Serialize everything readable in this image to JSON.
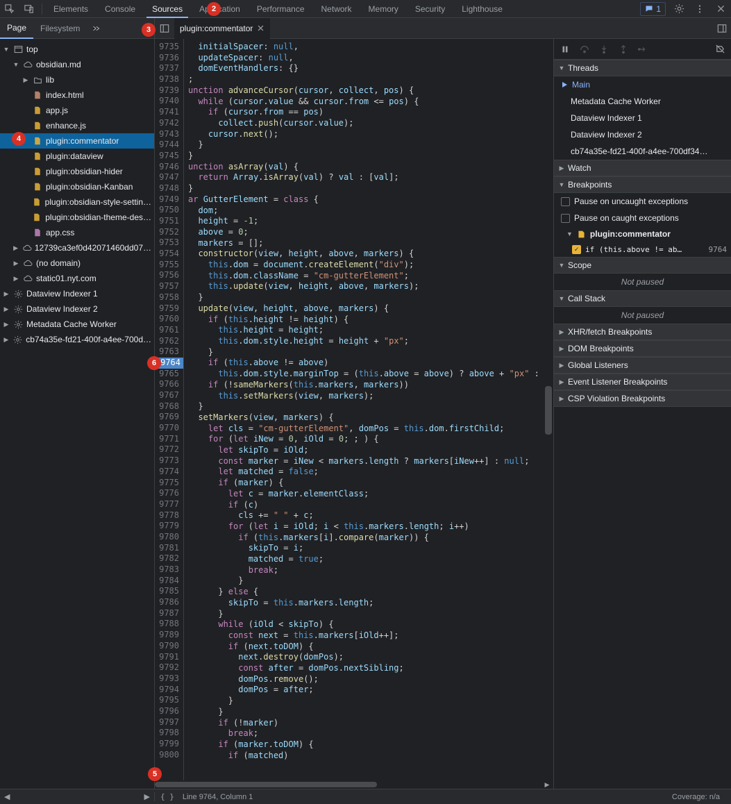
{
  "top_tabs": [
    "Elements",
    "Console",
    "Sources",
    "Application",
    "Performance",
    "Network",
    "Memory",
    "Security",
    "Lighthouse"
  ],
  "top_tab_active": 2,
  "msg_count": "1",
  "nav_tabs": [
    "Page",
    "Filesystem"
  ],
  "nav_tab_active": 0,
  "open_file": {
    "name": "plugin:commentator"
  },
  "tree": [
    {
      "d": 0,
      "tw": "▼",
      "ic": "win",
      "label": "top"
    },
    {
      "d": 1,
      "tw": "▼",
      "ic": "cloud",
      "label": "obsidian.md"
    },
    {
      "d": 2,
      "tw": "▶",
      "ic": "folder",
      "label": "lib"
    },
    {
      "d": 2,
      "tw": "",
      "ic": "html",
      "label": "index.html"
    },
    {
      "d": 2,
      "tw": "",
      "ic": "js",
      "label": "app.js"
    },
    {
      "d": 2,
      "tw": "",
      "ic": "js",
      "label": "enhance.js"
    },
    {
      "d": 2,
      "tw": "",
      "ic": "js",
      "label": "plugin:commentator",
      "sel": true
    },
    {
      "d": 2,
      "tw": "",
      "ic": "js",
      "label": "plugin:dataview"
    },
    {
      "d": 2,
      "tw": "",
      "ic": "js",
      "label": "plugin:obsidian-hider"
    },
    {
      "d": 2,
      "tw": "",
      "ic": "js",
      "label": "plugin:obsidian-Kanban"
    },
    {
      "d": 2,
      "tw": "",
      "ic": "js",
      "label": "plugin:obsidian-style-settin…"
    },
    {
      "d": 2,
      "tw": "",
      "ic": "js",
      "label": "plugin:obsidian-theme-des…"
    },
    {
      "d": 2,
      "tw": "",
      "ic": "css",
      "label": "app.css"
    },
    {
      "d": 1,
      "tw": "▶",
      "ic": "cloud",
      "label": "12739ca3ef0d42071460dd07…"
    },
    {
      "d": 1,
      "tw": "▶",
      "ic": "cloud",
      "label": "(no domain)"
    },
    {
      "d": 1,
      "tw": "▶",
      "ic": "cloud",
      "label": "static01.nyt.com"
    },
    {
      "d": 0,
      "tw": "▶",
      "ic": "gear",
      "label": "Dataview Indexer 1"
    },
    {
      "d": 0,
      "tw": "▶",
      "ic": "gear",
      "label": "Dataview Indexer 2"
    },
    {
      "d": 0,
      "tw": "▶",
      "ic": "gear",
      "label": "Metadata Cache Worker"
    },
    {
      "d": 0,
      "tw": "▶",
      "ic": "gear",
      "label": "cb74a35e-fd21-400f-a4ee-700d…"
    }
  ],
  "gutter_start": 9735,
  "gutter_end": 9800,
  "gutter_bp": 9764,
  "code_lines": [
    "  <span class='prop'>initialSpacer</span>: <span class='bool'>null</span>,",
    "  <span class='prop'>updateSpacer</span>: <span class='bool'>null</span>,",
    "  <span class='prop'>domEventHandlers</span>: {}",
    ";",
    "<span class='kw'>unction</span> <span class='fn'>advanceCursor</span>(<span class='prop'>cursor</span>, <span class='prop'>collect</span>, <span class='prop'>pos</span>) {",
    "  <span class='kw'>while</span> (<span class='prop'>cursor</span>.<span class='prop'>value</span> && <span class='prop'>cursor</span>.<span class='prop'>from</span> &lt;= <span class='prop'>pos</span>) {",
    "    <span class='kw'>if</span> (<span class='prop'>cursor</span>.<span class='prop'>from</span> == <span class='prop'>pos</span>)",
    "      <span class='prop'>collect</span>.<span class='fn'>push</span>(<span class='prop'>cursor</span>.<span class='prop'>value</span>);",
    "    <span class='prop'>cursor</span>.<span class='fn'>next</span>();",
    "  }",
    "}",
    "<span class='kw'>unction</span> <span class='fn'>asArray</span>(<span class='prop'>val</span>) {",
    "  <span class='kw'>return</span> <span class='prop'>Array</span>.<span class='fn'>isArray</span>(<span class='prop'>val</span>) ? <span class='prop'>val</span> : [<span class='prop'>val</span>];",
    "}",
    "<span class='kw'>ar</span> <span class='prop'>GutterElement</span> = <span class='kw'>class</span> {",
    "  <span class='prop'>dom</span>;",
    "  <span class='prop'>height</span> = <span class='num'>-1</span>;",
    "  <span class='prop'>above</span> = <span class='num'>0</span>;",
    "  <span class='prop'>markers</span> = [];",
    "  <span class='fn'>constructor</span>(<span class='prop'>view</span>, <span class='prop'>height</span>, <span class='prop'>above</span>, <span class='prop'>markers</span>) {",
    "    <span class='bool'>this</span>.<span class='prop'>dom</span> = <span class='prop'>document</span>.<span class='fn'>createElement</span>(<span class='str'>\"div\"</span>);",
    "    <span class='bool'>this</span>.<span class='prop'>dom</span>.<span class='prop'>className</span> = <span class='str'>\"cm-gutterElement\"</span>;",
    "    <span class='bool'>this</span>.<span class='fn'>update</span>(<span class='prop'>view</span>, <span class='prop'>height</span>, <span class='prop'>above</span>, <span class='prop'>markers</span>);",
    "  }",
    "  <span class='fn'>update</span>(<span class='prop'>view</span>, <span class='prop'>height</span>, <span class='prop'>above</span>, <span class='prop'>markers</span>) {",
    "    <span class='kw'>if</span> (<span class='bool'>this</span>.<span class='prop'>height</span> != <span class='prop'>height</span>) {",
    "      <span class='bool'>this</span>.<span class='prop'>height</span> = <span class='prop'>height</span>;",
    "      <span class='bool'>this</span>.<span class='prop'>dom</span>.<span class='prop'>style</span>.<span class='prop'>height</span> = <span class='prop'>height</span> + <span class='str'>\"px\"</span>;",
    "    }",
    "    <span class='kw'>if</span> (<span class='bool'>this</span>.<span class='prop'>above</span> != <span class='prop'>above</span>)",
    "      <span class='bool'>this</span>.<span class='prop'>dom</span>.<span class='prop'>style</span>.<span class='prop'>marginTop</span> = (<span class='bool'>this</span>.<span class='prop'>above</span> = <span class='prop'>above</span>) ? <span class='prop'>above</span> + <span class='str'>\"px\"</span> :",
    "    <span class='kw'>if</span> (!<span class='fn'>sameMarkers</span>(<span class='bool'>this</span>.<span class='prop'>markers</span>, <span class='prop'>markers</span>))",
    "      <span class='bool'>this</span>.<span class='fn'>setMarkers</span>(<span class='prop'>view</span>, <span class='prop'>markers</span>);",
    "  }",
    "  <span class='fn'>setMarkers</span>(<span class='prop'>view</span>, <span class='prop'>markers</span>) {",
    "    <span class='kw'>let</span> <span class='prop'>cls</span> = <span class='str'>\"cm-gutterElement\"</span>, <span class='prop'>domPos</span> = <span class='bool'>this</span>.<span class='prop'>dom</span>.<span class='prop'>firstChild</span>;",
    "    <span class='kw'>for</span> (<span class='kw'>let</span> <span class='prop'>iNew</span> = <span class='num'>0</span>, <span class='prop'>iOld</span> = <span class='num'>0</span>; ; ) {",
    "      <span class='kw'>let</span> <span class='prop'>skipTo</span> = <span class='prop'>iOld</span>;",
    "      <span class='kw'>const</span> <span class='prop'>marker</span> = <span class='prop'>iNew</span> &lt; <span class='prop'>markers</span>.<span class='prop'>length</span> ? <span class='prop'>markers</span>[<span class='prop'>iNew</span>++] : <span class='bool'>null</span>;",
    "      <span class='kw'>let</span> <span class='prop'>matched</span> = <span class='bool'>false</span>;",
    "      <span class='kw'>if</span> (<span class='prop'>marker</span>) {",
    "        <span class='kw'>let</span> <span class='prop'>c</span> = <span class='prop'>marker</span>.<span class='prop'>elementClass</span>;",
    "        <span class='kw'>if</span> (<span class='prop'>c</span>)",
    "          <span class='prop'>cls</span> += <span class='str'>\" \"</span> + <span class='prop'>c</span>;",
    "        <span class='kw'>for</span> (<span class='kw'>let</span> <span class='prop'>i</span> = <span class='prop'>iOld</span>; <span class='prop'>i</span> &lt; <span class='bool'>this</span>.<span class='prop'>markers</span>.<span class='prop'>length</span>; <span class='prop'>i</span>++)",
    "          <span class='kw'>if</span> (<span class='bool'>this</span>.<span class='prop'>markers</span>[<span class='prop'>i</span>].<span class='fn'>compare</span>(<span class='prop'>marker</span>)) {",
    "            <span class='prop'>skipTo</span> = <span class='prop'>i</span>;",
    "            <span class='prop'>matched</span> = <span class='bool'>true</span>;",
    "            <span class='kw'>break</span>;",
    "          }",
    "      } <span class='kw'>else</span> {",
    "        <span class='prop'>skipTo</span> = <span class='bool'>this</span>.<span class='prop'>markers</span>.<span class='prop'>length</span>;",
    "      }",
    "      <span class='kw'>while</span> (<span class='prop'>iOld</span> &lt; <span class='prop'>skipTo</span>) {",
    "        <span class='kw'>const</span> <span class='prop'>next</span> = <span class='bool'>this</span>.<span class='prop'>markers</span>[<span class='prop'>iOld</span>++];",
    "        <span class='kw'>if</span> (<span class='prop'>next</span>.<span class='prop'>toDOM</span>) {",
    "          <span class='prop'>next</span>.<span class='fn'>destroy</span>(<span class='prop'>domPos</span>);",
    "          <span class='kw'>const</span> <span class='prop'>after</span> = <span class='prop'>domPos</span>.<span class='prop'>nextSibling</span>;",
    "          <span class='prop'>domPos</span>.<span class='fn'>remove</span>();",
    "          <span class='prop'>domPos</span> = <span class='prop'>after</span>;",
    "        }",
    "      }",
    "      <span class='kw'>if</span> (!<span class='prop'>marker</span>)",
    "        <span class='kw'>break</span>;",
    "      <span class='kw'>if</span> (<span class='prop'>marker</span>.<span class='prop'>toDOM</span>) {",
    "        <span class='kw'>if</span> (<span class='prop'>matched</span>)"
  ],
  "threads": {
    "header": "Threads",
    "active": "Main",
    "items": [
      "Metadata Cache Worker",
      "Dataview Indexer 1",
      "Dataview Indexer 2",
      "cb74a35e-fd21-400f-a4ee-700df34…"
    ]
  },
  "watch": "Watch",
  "breakpoints": {
    "header": "Breakpoints",
    "pause_uncaught": "Pause on uncaught exceptions",
    "pause_caught": "Pause on caught exceptions",
    "file": "plugin:commentator",
    "line_text": "if (this.above != ab…",
    "line_no": "9764"
  },
  "scope": {
    "header": "Scope",
    "not_paused": "Not paused"
  },
  "callstack": {
    "header": "Call Stack",
    "not_paused": "Not paused"
  },
  "extra_sections": [
    "XHR/fetch Breakpoints",
    "DOM Breakpoints",
    "Global Listeners",
    "Event Listener Breakpoints",
    "CSP Violation Breakpoints"
  ],
  "status": {
    "linecol": "Line 9764, Column 1",
    "coverage": "Coverage: n/a"
  },
  "badges": {
    "b2": "2",
    "b3": "3",
    "b4": "4",
    "b5": "5",
    "b6": "6"
  }
}
